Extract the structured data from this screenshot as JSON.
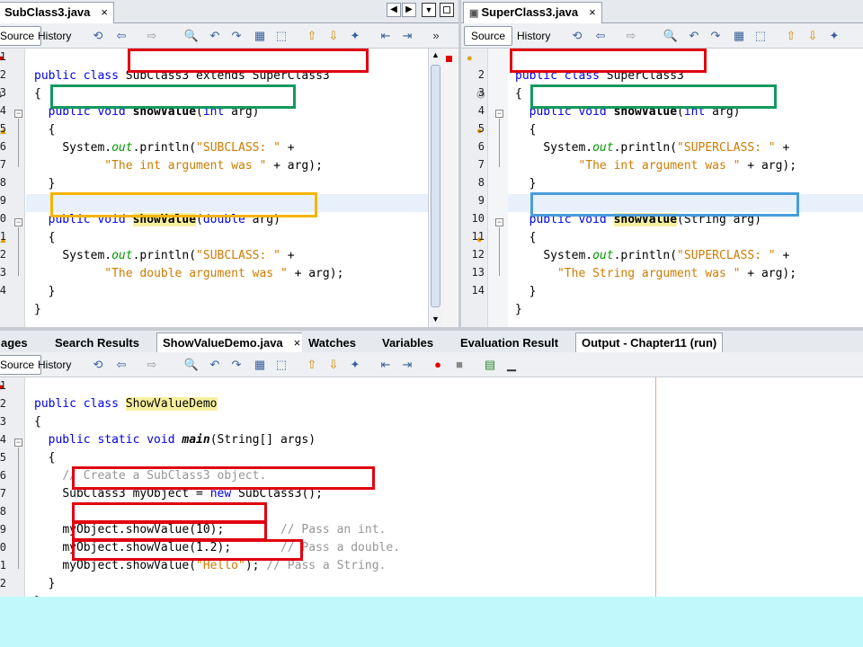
{
  "left_editor": {
    "tab_title": "SubClass3.java",
    "close_glyph": "×",
    "source_label": "Source",
    "history_label": "History",
    "line_numbers": [
      "1",
      "2",
      "3",
      "4",
      "5",
      "6",
      "7",
      "8",
      "9",
      "10",
      "11",
      "12",
      "13",
      "14"
    ],
    "code": {
      "l1_kw": "public class ",
      "l1_rest": "SubClass3 extends SuperClass3",
      "l2": "{",
      "l3_kw": "public void ",
      "l3_name": "showValue",
      "l3_p1": "(",
      "l3_type": "int",
      "l3_rest": " arg)",
      "l4": "{",
      "l5_a": "System.",
      "l5_out": "out",
      "l5_b": ".println(",
      "l5_str": "\"SUBCLASS: \"",
      "l5_c": " +",
      "l6_str": "\"The int argument was \"",
      "l6_rest": " + arg);",
      "l7": "}",
      "l9_kw": "public void ",
      "l9_name": "showValue",
      "l9_p1": "(",
      "l9_type": "double",
      "l9_rest": " arg)",
      "l10": "{",
      "l11_a": "System.",
      "l11_out": "out",
      "l11_b": ".println(",
      "l11_str": "\"SUBCLASS: \"",
      "l11_c": " +",
      "l12_str": "\"The double argument was \"",
      "l12_rest": " + arg);",
      "l13": "}",
      "l14": "}"
    }
  },
  "right_editor": {
    "tab_title": "SuperClass3.java",
    "close_glyph": "×",
    "source_label": "Source",
    "history_label": "History",
    "line_numbers": [
      "2",
      "3",
      "4",
      "5",
      "6",
      "7",
      "8",
      "9",
      "10",
      "11",
      "12",
      "13",
      "14"
    ],
    "code": {
      "l1_kw": "public class ",
      "l1_rest": "SuperClass3",
      "l2": "{",
      "l3_kw": "public void ",
      "l3_name": "showValue",
      "l3_p1": "(",
      "l3_type": "int",
      "l3_rest": " arg)",
      "l4": "{",
      "l5_a": "System.",
      "l5_out": "out",
      "l5_b": ".println(",
      "l5_str": "\"SUPERCLASS: \"",
      "l5_c": " +",
      "l6_str": "\"The int argument was \"",
      "l6_rest": " + arg);",
      "l7": "}",
      "l9_kw": "public void ",
      "l9_name": "showValue",
      "l9_rest": "(String arg)",
      "l10": "{",
      "l11_a": "System.",
      "l11_out": "out",
      "l11_b": ".println(",
      "l11_str": "\"SUPERCLASS: \"",
      "l11_c": " +",
      "l12_str": "\"The String argument was \"",
      "l12_rest": " + arg);",
      "l13": "}",
      "l14": "}"
    }
  },
  "bottom_tabs": [
    "ages",
    "Search Results",
    "ShowValueDemo.java",
    "Watches",
    "Variables",
    "Evaluation Result",
    "Output - Chapter11 (run)"
  ],
  "bottom_editor": {
    "close_glyph": "×",
    "source_label": "Source",
    "history_label": "History",
    "line_numbers": [
      "1",
      "2",
      "3",
      "4",
      "5",
      "6",
      "7",
      "8",
      "9",
      "10",
      "11",
      "12"
    ],
    "code": {
      "l1_kw": "public class ",
      "l1_name": "ShowValueDemo",
      "l2": "{",
      "l3_kw": "public static void ",
      "l3_name": "main",
      "l3_rest": "(String[] args)",
      "l4": "{",
      "l5_cmt": "// Create a SubClass3 object.",
      "l6_a": "SubClass3 myObject = ",
      "l6_kw": "new",
      "l6_b": " SubClass3();",
      "l8_code": "myObject.showValue(10);",
      "l8_cmt": "// Pass an int.",
      "l9_code": "myObject.showValue(1.2);",
      "l9_cmt": "// Pass a double.",
      "l10_a": "myObject.showValue(",
      "l10_str": "\"Hello\"",
      "l10_b": ");",
      "l10_cmt": "// Pass a String.",
      "l11": "}",
      "l12": "}"
    }
  },
  "colors": {
    "red_box": "#e0000e",
    "green_box": "#129a5e",
    "orange_box": "#f5b400",
    "blue_box": "#4a9cdc",
    "keyword": "#0000e6",
    "string": "#ce7b00",
    "background": "#c0f8fc"
  }
}
